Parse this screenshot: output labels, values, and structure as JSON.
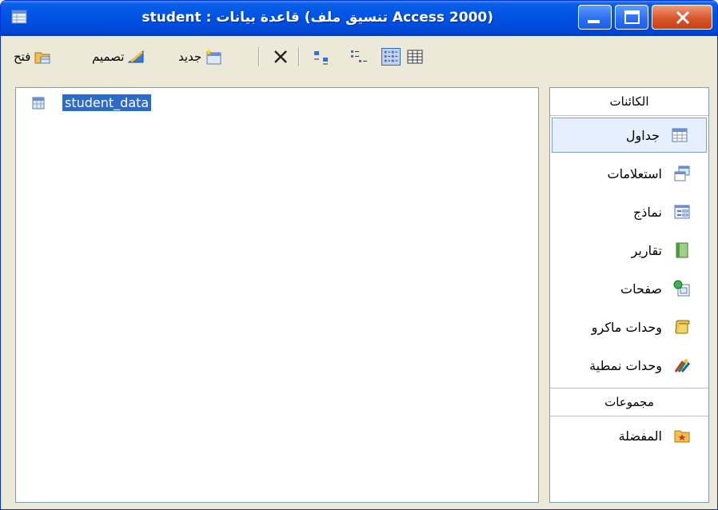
{
  "window": {
    "title": "student : قاعدة بيانات (تنسيق ملف Access 2000)"
  },
  "toolbar": {
    "open_label": "فتح",
    "design_label": "تصميم",
    "new_label": "جديد"
  },
  "list": {
    "items": [
      "student_data"
    ]
  },
  "objects": {
    "header": "الكائنات",
    "items": [
      {
        "label": "جداول",
        "icon": "table-icon"
      },
      {
        "label": "استعلامات",
        "icon": "query-icon"
      },
      {
        "label": "نماذج",
        "icon": "form-icon"
      },
      {
        "label": "تقارير",
        "icon": "report-icon"
      },
      {
        "label": "صفحات",
        "icon": "page-icon"
      },
      {
        "label": "وحدات ماكرو",
        "icon": "macro-icon"
      },
      {
        "label": "وحدات نمطية",
        "icon": "module-icon"
      }
    ],
    "selected": "جداول"
  },
  "groups": {
    "header": "مجموعات",
    "items": [
      {
        "label": "المفضلة",
        "icon": "favorites-folder-icon"
      }
    ]
  }
}
